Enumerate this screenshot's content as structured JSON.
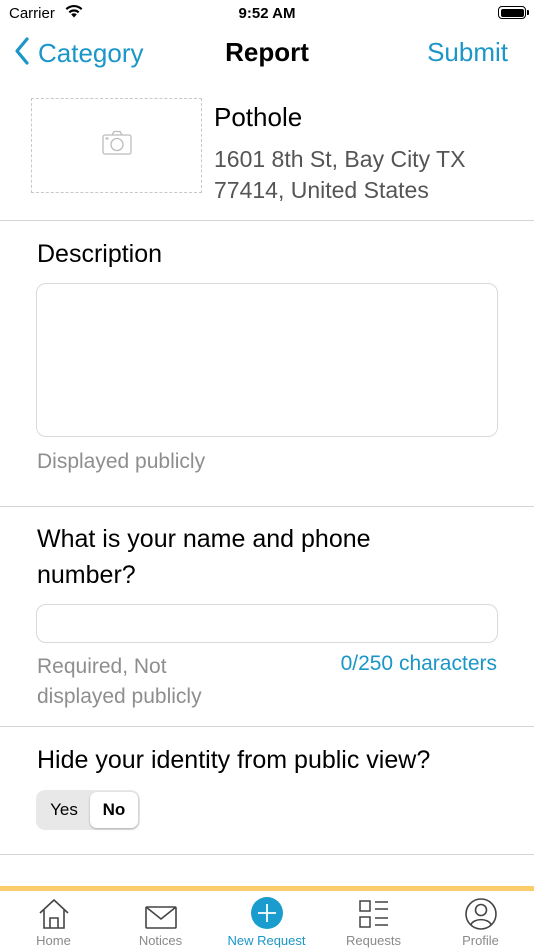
{
  "status_bar": {
    "carrier": "Carrier",
    "time": "9:52 AM"
  },
  "nav": {
    "back_label": "Category",
    "title": "Report",
    "submit_label": "Submit"
  },
  "report": {
    "category": "Pothole",
    "address": "1601 8th St, Bay City TX 77414, United States",
    "photo_icon": "camera-icon"
  },
  "description": {
    "label": "Description",
    "value": "",
    "hint": "Displayed publicly"
  },
  "contact": {
    "label": "What is your name and phone number?",
    "value": "",
    "hint": "Required, Not displayed publicly",
    "counter": "0/250 characters"
  },
  "identity": {
    "label": "Hide your identity from public view?",
    "options": [
      "Yes",
      "No"
    ],
    "selected": "No"
  },
  "tabbar": {
    "accent_color": "#f9cd6b",
    "active_color": "#1a96c8",
    "items": [
      {
        "label": "Home",
        "icon": "home-icon"
      },
      {
        "label": "Notices",
        "icon": "envelope-icon"
      },
      {
        "label": "New Request",
        "icon": "plus-circle-icon",
        "active": true
      },
      {
        "label": "Requests",
        "icon": "list-icon"
      },
      {
        "label": "Profile",
        "icon": "person-icon"
      }
    ]
  }
}
